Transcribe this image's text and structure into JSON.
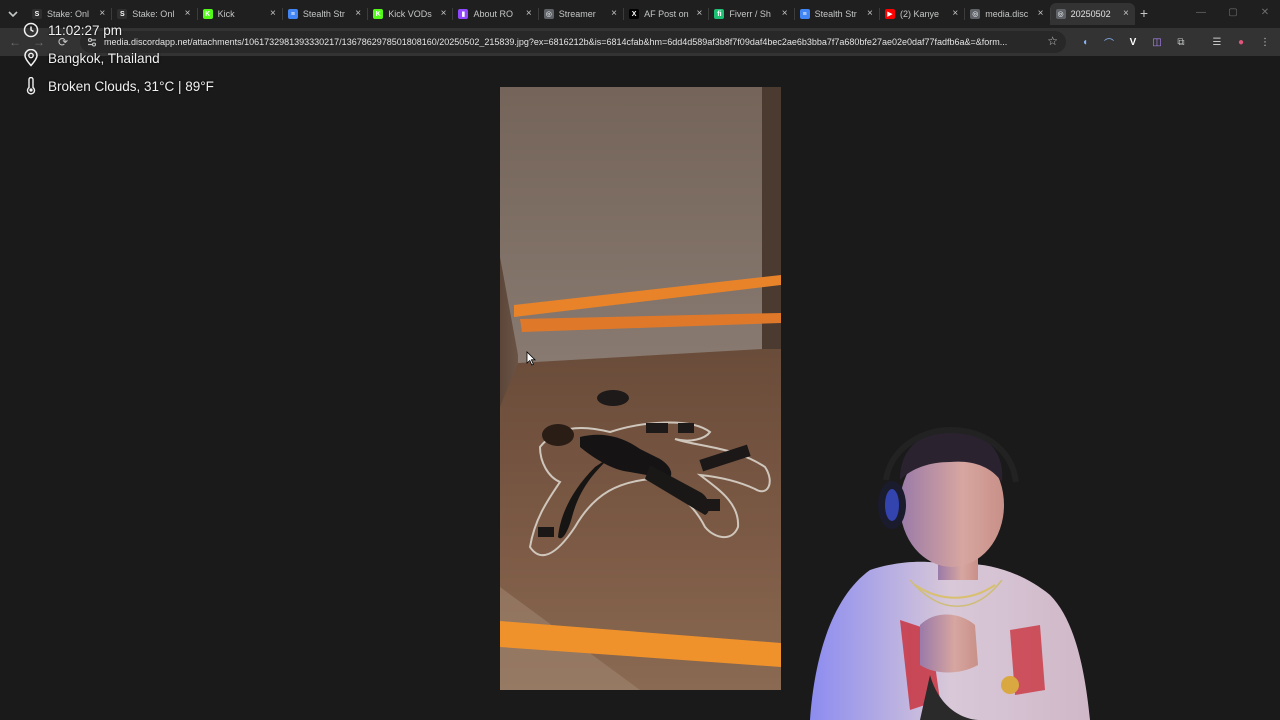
{
  "browser": {
    "tabs": [
      {
        "label": "Stake: Onl",
        "icon": "stake-icon",
        "color": "#2f2f2f",
        "glyph": "S"
      },
      {
        "label": "Stake: Onl",
        "icon": "stake-icon",
        "color": "#2f2f2f",
        "glyph": "S"
      },
      {
        "label": "Kick",
        "icon": "kick-icon",
        "color": "#53fc18",
        "glyph": "K"
      },
      {
        "label": "Stealth Str",
        "icon": "docs-icon",
        "color": "#4285f4",
        "glyph": "≡"
      },
      {
        "label": "Kick VODs",
        "icon": "kick-icon",
        "color": "#53fc18",
        "glyph": "K"
      },
      {
        "label": "About RO",
        "icon": "twitch-icon",
        "color": "#9146ff",
        "glyph": "▮"
      },
      {
        "label": "Streamer",
        "icon": "globe-icon",
        "color": "#5f6368",
        "glyph": "◎"
      },
      {
        "label": "AF Post on",
        "icon": "x-icon",
        "color": "#000000",
        "glyph": "X"
      },
      {
        "label": "Fiverr / Sh",
        "icon": "fiverr-icon",
        "color": "#1dbf73",
        "glyph": "fi"
      },
      {
        "label": "Stealth Str",
        "icon": "docs-icon",
        "color": "#4285f4",
        "glyph": "≡"
      },
      {
        "label": "(2) Kanye",
        "icon": "youtube-icon",
        "color": "#ff0000",
        "glyph": "▶"
      },
      {
        "label": "media.disc",
        "icon": "globe-icon",
        "color": "#5f6368",
        "glyph": "◎"
      },
      {
        "label": "20250502",
        "icon": "globe-icon",
        "color": "#5f6368",
        "glyph": "◎"
      }
    ],
    "active_tab_index": 12,
    "url": "media.discordapp.net/attachments/1061732981393330217/1367862978501808160/20250502_215839.jpg?ex=6816212b&is=6814cfab&hm=6dd4d589af3b8f7f09daf4bec2ae6b3bba7f7a680bfe27ae02e0daf77fadfb6a&=&form..."
  },
  "overlay": {
    "time": "11:02:27 pm",
    "location": "Bangkok, Thailand",
    "weather": "Broken Clouds, 31°C | 89°F"
  },
  "colors": {
    "chrome_bg": "#1f1f1f",
    "toolbar_bg": "#333333",
    "page_bg": "#1a1a1a",
    "tape": "#f08a24"
  }
}
